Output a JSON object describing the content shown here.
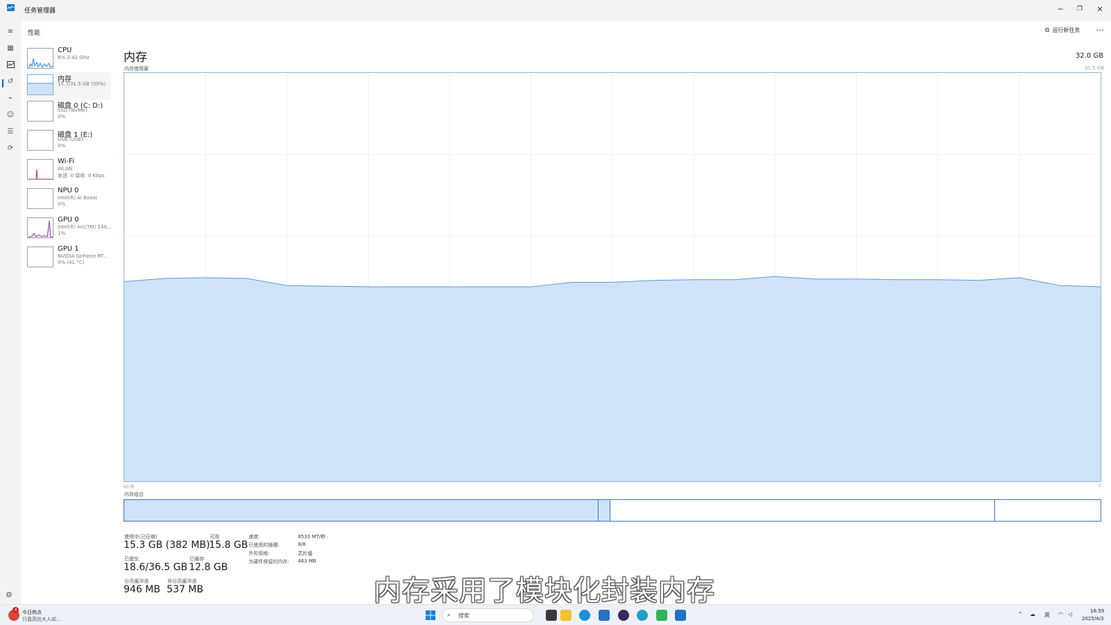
{
  "window": {
    "title": "任务管理器"
  },
  "header": {
    "section": "性能",
    "run_task": "运行新任务"
  },
  "devices": [
    {
      "name": "CPU",
      "sub": "6% 2.42 GHz",
      "sub2": ""
    },
    {
      "name": "内存",
      "sub": "15.7/31.5 GB (50%)",
      "sub2": ""
    },
    {
      "name": "磁盘 0 (C: D:)",
      "sub": "SSD (NVMe)",
      "sub2": "0%"
    },
    {
      "name": "磁盘 1 (E:)",
      "sub": "USB (USB)",
      "sub2": "0%"
    },
    {
      "name": "Wi-Fi",
      "sub": "WLAN",
      "sub2": "发送: 0 接收: 0 Kbps"
    },
    {
      "name": "NPU 0",
      "sub": "Intel(R) AI Boost",
      "sub2": "0%"
    },
    {
      "name": "GPU 0",
      "sub": "Intel(R) Arc(TM) 140...",
      "sub2": "1%"
    },
    {
      "name": "GPU 1",
      "sub": "NVIDIA GeForce RT...",
      "sub2": "0% (41 °C)"
    }
  ],
  "memory": {
    "title": "内存",
    "total": "32.0 GB",
    "usage_label": "内存使用量",
    "usage_max": "31.5 GB",
    "axis_left": "60 秒",
    "axis_right": "0",
    "composition_label": "内存组合",
    "stats": {
      "in_use_label": "使用中(已压缩)",
      "in_use_value": "15.3 GB (382 MB)",
      "available_label": "可用",
      "available_value": "15.8 GB",
      "committed_label": "已提交",
      "committed_value": "18.6/36.5 GB",
      "cached_label": "已缓存",
      "cached_value": "12.8 GB",
      "paged_label": "分页缓冲池",
      "paged_value": "946 MB",
      "nonpaged_label": "非分页缓冲池",
      "nonpaged_value": "537 MB"
    },
    "details": [
      {
        "label": "速度:",
        "value": "8533 MT/秒"
      },
      {
        "label": "已使用的插槽:",
        "value": "8/8"
      },
      {
        "label": "外形规格:",
        "value": "芯片组"
      },
      {
        "label": "为硬件保留的内存:",
        "value": "463 MB"
      }
    ]
  },
  "chart_data": {
    "type": "area",
    "x": [
      60,
      57.5,
      55,
      52.5,
      50,
      47.5,
      45,
      42.5,
      40,
      37.5,
      35,
      32.5,
      30,
      27.5,
      25,
      22.5,
      20,
      17.5,
      15,
      12.5,
      10,
      7.5,
      5,
      2.5,
      0
    ],
    "values": [
      15.4,
      15.65,
      15.7,
      15.65,
      15.1,
      15.05,
      15.0,
      15.0,
      15.0,
      15.0,
      15.0,
      15.35,
      15.35,
      15.5,
      15.55,
      15.55,
      15.8,
      15.6,
      15.6,
      15.55,
      15.55,
      15.5,
      15.7,
      15.1,
      15.0
    ],
    "ylim": [
      0,
      31.5
    ],
    "xlim": [
      60,
      0
    ],
    "grid": true,
    "fill": "#cfe3f8",
    "stroke": "#5a9bd8",
    "composition": [
      {
        "name": "in_use",
        "fraction": 0.486,
        "color": "#cfe3f8"
      },
      {
        "name": "modified",
        "fraction": 0.012,
        "color": "#cfe3f8"
      },
      {
        "name": "standby",
        "fraction": 0.394,
        "color": "#ffffff"
      },
      {
        "name": "free",
        "fraction": 0.108,
        "color": "#ffffff"
      }
    ]
  },
  "overlay": {
    "subtitle": "内存采用了模块化封装内存"
  },
  "taskbar": {
    "news_badge": "4",
    "news_title": "今日热点",
    "news_sub": "只靠高仿大人却...",
    "search": "搜索",
    "ime": "英",
    "time": "16:59",
    "date": "2025/4/3"
  }
}
